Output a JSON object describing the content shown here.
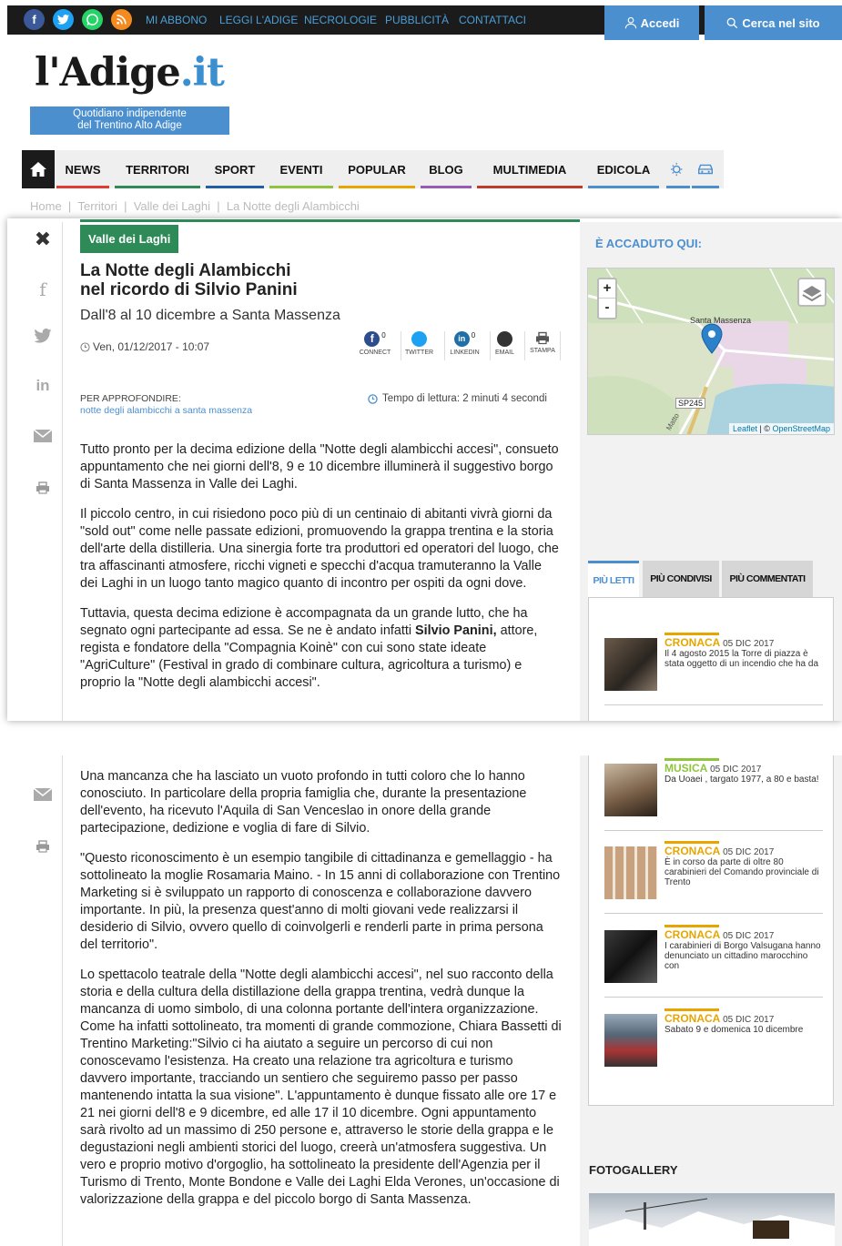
{
  "topbar": {
    "links": [
      "MI ABBONO",
      "LEGGI L'ADIGE",
      "NECROLOGIE",
      "PUBBLICITÀ",
      "CONTATTACI"
    ],
    "login": "Accedi",
    "search": "Cerca nel sito",
    "social": [
      {
        "name": "facebook-icon",
        "glyph": "f",
        "color": "#3b5998"
      },
      {
        "name": "twitter-icon",
        "glyph": "t",
        "color": "#1da1f2"
      },
      {
        "name": "whatsapp-icon",
        "glyph": "w",
        "color": "#25d366"
      },
      {
        "name": "rss-icon",
        "glyph": "r",
        "color": "#f58a1f"
      }
    ]
  },
  "logo": {
    "main": "l'Adige",
    "suffix": ".it",
    "tagline_1": "Quotidiano indipendente",
    "tagline_2": "del Trentino Alto Adige"
  },
  "nav": {
    "items": [
      {
        "label": "NEWS",
        "color": "#e03c31"
      },
      {
        "label": "TERRITORI",
        "color": "#2e8b57"
      },
      {
        "label": "SPORT",
        "color": "#1f5fa8"
      },
      {
        "label": "EVENTI",
        "color": "#8fc43f"
      },
      {
        "label": "POPULAR",
        "color": "#e8a500"
      },
      {
        "label": "BLOG",
        "color": "#9b59b6"
      },
      {
        "label": "MULTIMEDIA",
        "color": "#c0392b"
      },
      {
        "label": "EDICOLA",
        "color": "#4b8fcf"
      }
    ]
  },
  "breadcrumb": [
    "Home",
    "Territori",
    "Valle dei Laghi",
    "La Notte degli Alambicchi"
  ],
  "article": {
    "category": "Valle dei Laghi",
    "title_1": "La Notte degli Alambicchi",
    "title_2": "nel ricordo di Silvio Panini",
    "subtitle": "Dall'8 al 10 dicembre a Santa Massenza",
    "date": "Ven, 01/12/2017 - 10:07",
    "share": [
      {
        "label": "CONNECT",
        "count": "0"
      },
      {
        "label": "TWITTER",
        "count": ""
      },
      {
        "label": "LINKEDIN",
        "count": "0"
      },
      {
        "label": "EMAIL",
        "count": ""
      },
      {
        "label": "STAMPA",
        "count": ""
      }
    ],
    "approfondire_label": "PER APPROFONDIRE:",
    "approfondire_link": "notte degli alambicchi a santa massenza",
    "reading_time": "Tempo di lettura: 2 minuti 4 secondi",
    "p1": "Tutto pronto per la decima edizione della \"Notte degli alambicchi accesi\", consueto appuntamento che nei giorni dell'8, 9 e 10 dicembre illuminerà il suggestivo borgo di Santa Massenza in Valle dei Laghi.",
    "p2": "Il piccolo centro, in cui risiedono poco più di un centinaio di abitanti vivrà giorni da \"sold out\" come nelle passate edizioni, promuovendo la grappa trentina e la storia dell'arte della distilleria. Una sinergia forte tra produttori ed operatori del luogo, che tra affascinanti atmosfere, ricchi vigneti e specchi d'acqua tramuteranno la Valle dei Laghi in un luogo tanto magico quanto di incontro per ospiti da ogni dove.",
    "p3a": "Tuttavia, questa decima edizione è accompagnata da un grande lutto, che ha segnato ogni partecipante ad essa. Se ne è andato infatti ",
    "p3b": "Silvio Panini,",
    "p3c": " attore, regista e fondatore della \"Compagnia Koinè\" con cui sono state ideate \"AgriCulture\" (Festival in grado di combinare cultura, agricoltura a turismo) e proprio la \"Notte degli alambicchi accesi\".",
    "p4": "Una mancanza che ha lasciato un vuoto profondo in tutti coloro che lo hanno conosciuto. In particolare della propria famiglia che, durante la presentazione dell'evento, ha ricevuto l'Aquila di San Venceslao in onore della grande partecipazione, dedizione e voglia di fare di Silvio.",
    "p5": "\"Questo riconoscimento è un esempio tangibile di cittadinanza e gemellaggio - ha sottolineato la moglie Rosamaria Maino. - In 15 anni di collaborazione con Trentino Marketing si è sviluppato un rapporto di conoscenza e collaborazione davvero importante. In più, la presenza quest'anno di molti giovani vede realizzarsi il desiderio di Silvio, ovvero quello di coinvolgerli e renderli parte in prima persona del territorio\".",
    "p6": "Lo spettacolo teatrale della \"Notte degli alambicchi accesi\", nel suo racconto della storia e della cultura della distillazione della grappa trentina, vedrà dunque la mancanza di uomo simbolo, di una colonna portante dell'intera organizzazione. Come ha infatti sottolineato, tra momenti di grande commozione, Chiara Bassetti di Trentino Marketing:\"Silvio ci ha aiutato a seguire un percorso di cui non conoscevamo l'esistenza. Ha creato una relazione tra agricoltura e turismo davvero importante, tracciando un sentiero che seguiremo passo per passo mantenendo intatta la sua visione\". L'appuntamento è dunque fissato alle ore 17 e 21 nei giorni dell'8 e 9 dicembre, ed alle 17 il 10 dicembre. Ogni appuntamento sarà rivolto ad un massimo di 250 persone e, attraverso le storie della grappa e le degustazioni negli ambienti storici del luogo, creerà un'atmosfera suggestiva. Un vero e proprio motivo d'orgoglio, ha sottolineato la presidente dell'Agenzia per il Turismo di Trento, Monte Bondone e Valle dei Laghi Elda Verones, un'occasione di valorizzazione della grappa e del piccolo borgo di Santa Massenza."
  },
  "sidebar": {
    "map_title": "È ACCADUTO QUI:",
    "map_place": "Santa Massenza",
    "map_road": "SP245",
    "map_street": "Matto",
    "map_zoom_in": "+",
    "map_zoom_out": "-",
    "map_credit_1": "Leaflet",
    "map_credit_sep": " | © ",
    "map_credit_2": "OpenStreetMap",
    "tabs": [
      "PIÙ LETTI",
      "PIÙ CONDIVISI",
      "PIÙ COMMENTATI"
    ],
    "news": [
      {
        "cat": "CRONACA",
        "date": "05 DIC 2017",
        "text": "Il 4 agosto 2015 la Torre di piazza è stata oggetto di un incendio che ha da"
      },
      {
        "cat": "MUSICA",
        "date": "05 DIC 2017",
        "text": "Da Uoaei , targato 1977, a 80 e basta!"
      },
      {
        "cat": "CRONACA",
        "date": "05 DIC 2017",
        "text": "È in corso da parte di oltre 80 carabinieri del Comando provinciale di Trento"
      },
      {
        "cat": "CRONACA",
        "date": "05 DIC 2017",
        "text": "I carabinieri di Borgo Valsugana hanno denunciato un cittadino marocchino con"
      },
      {
        "cat": "CRONACA",
        "date": "05 DIC 2017",
        "text": "Sabato 9 e domenica 10 dicembre"
      }
    ],
    "fotogallery": "FOTOGALLERY"
  }
}
